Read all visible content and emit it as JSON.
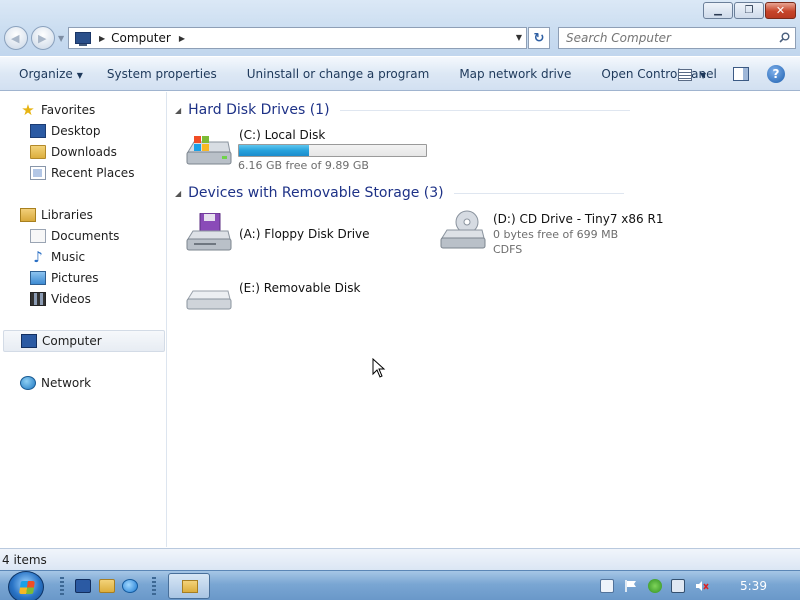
{
  "window": {
    "minimize_glyph": "▁",
    "maximize_glyph": "❐",
    "close_glyph": "✕"
  },
  "address": {
    "location": "Computer",
    "search_placeholder": "Search Computer"
  },
  "toolbar": {
    "organize": "Organize",
    "system_properties": "System properties",
    "uninstall": "Uninstall or change a program",
    "map_network_drive": "Map network drive",
    "open_control_panel": "Open Control Panel",
    "help_glyph": "?"
  },
  "navigation": {
    "favorites": "Favorites",
    "desktop": "Desktop",
    "downloads": "Downloads",
    "recent_places": "Recent Places",
    "libraries": "Libraries",
    "documents": "Documents",
    "music": "Music",
    "pictures": "Pictures",
    "videos": "Videos",
    "computer": "Computer",
    "network": "Network"
  },
  "groups": {
    "hard_disk": "Hard Disk Drives (1)",
    "removable": "Devices with Removable Storage (3)"
  },
  "drives": {
    "c": {
      "name": "(C:) Local Disk",
      "free": "6.16 GB free of 9.89 GB",
      "used_fraction": 0.377
    },
    "a": {
      "name": "(A:) Floppy Disk Drive"
    },
    "d": {
      "name": "(D:) CD Drive - Tiny7 x86 R1",
      "free": "0 bytes free of 699 MB",
      "fs": "CDFS"
    },
    "e": {
      "name": "(E:) Removable Disk"
    }
  },
  "status": {
    "items": "4 items"
  },
  "taskbar": {
    "clock": "5:39"
  },
  "colors": {
    "accent": "#1e3287",
    "bar_fill": "#27a2dc",
    "taskbar": "#7aa6d3"
  }
}
